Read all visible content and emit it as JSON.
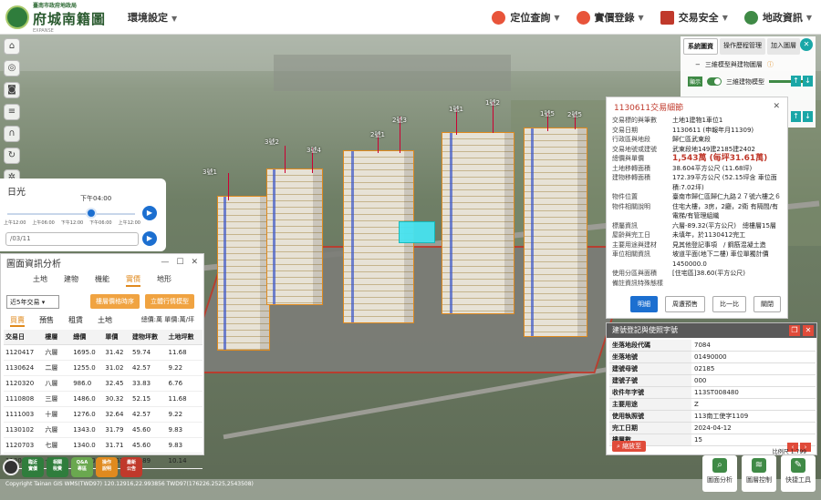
{
  "header": {
    "logo_sub": "臺南市政府地政局",
    "logo_main": "府城南籍圖",
    "logo_en": "EXPANSE",
    "env_menu": "環境設定",
    "nav": [
      {
        "label": "定位查詢",
        "icon": "location-pin-icon",
        "color": "#e8543a"
      },
      {
        "label": "實價登錄",
        "icon": "coin-icon",
        "color": "#e8543a"
      },
      {
        "label": "交易安全",
        "icon": "house-shield-icon",
        "color": "#c0392b"
      },
      {
        "label": "地政資訊",
        "icon": "sprout-icon",
        "color": "#3f8a46"
      }
    ]
  },
  "left_tools": [
    "home-icon",
    "locate-icon",
    "camera-icon",
    "layers-icon",
    "measure-icon",
    "rotate-icon",
    "settings-icon"
  ],
  "sun": {
    "title": "日光",
    "time": "下午04:00",
    "ticks": [
      "上午12:00",
      "上午06:00",
      "下午12:00",
      "下午06:00",
      "上午12:00"
    ],
    "date": "/03/11",
    "level": 0.66
  },
  "analysis": {
    "title": "圖面資訊分析",
    "tabs": [
      "土地",
      "建物",
      "機能",
      "實價",
      "地形"
    ],
    "active_tab": "實價",
    "period": "近5年交易",
    "buttons": [
      "樓層價格時序",
      "立體行情模型"
    ],
    "subtabs": [
      "買賣",
      "預售",
      "租賃",
      "土地"
    ],
    "unit_note": "總價:萬 單價:萬/坪",
    "columns": [
      "交易日",
      "樓層",
      "總價",
      "單價",
      "建物坪數",
      "土地坪數"
    ],
    "rows": [
      [
        "1120417",
        "六層",
        "1695.0",
        "31.42",
        "59.74",
        "11.68"
      ],
      [
        "1130624",
        "二層",
        "1255.0",
        "31.02",
        "42.57",
        "9.22"
      ],
      [
        "1120320",
        "八層",
        "986.0",
        "32.45",
        "33.83",
        "6.76"
      ],
      [
        "1110808",
        "三層",
        "1486.0",
        "30.32",
        "52.15",
        "11.68"
      ],
      [
        "1111003",
        "十層",
        "1276.0",
        "32.64",
        "42.57",
        "9.22"
      ],
      [
        "1130102",
        "六層",
        "1343.0",
        "31.79",
        "45.60",
        "9.83"
      ],
      [
        "1120703",
        "七層",
        "1340.0",
        "31.71",
        "45.60",
        "9.83"
      ],
      [
        "1130620",
        "十四層",
        "1346.0",
        "31.63",
        "45.89",
        "10.14"
      ]
    ]
  },
  "bottom_left": [
    {
      "label": "臨近\n實價",
      "color": "#2f7d3c"
    },
    {
      "label": "相關\n稅費",
      "color": "#2f7d3c"
    },
    {
      "label": "Q&A\n專區",
      "color": "#6aa84f"
    },
    {
      "label": "操作\n說明",
      "color": "#e08a1e"
    },
    {
      "label": "最新\n公告",
      "color": "#c0392b"
    }
  ],
  "layers": {
    "tabs": [
      "系統圖資",
      "操作歷程管理",
      "加入圖層"
    ],
    "group": "三維模型與建物圖層",
    "item": "三維建物模型",
    "toggle_label": "顯示"
  },
  "detail": {
    "title": "1130611交易細節",
    "fields": [
      [
        "交易標的與筆數",
        "土地1建物1車位1"
      ],
      [
        "交易日期",
        "1130611 (申報年月11309)"
      ],
      [
        "行政區與地段",
        "歸仁區武東段"
      ],
      [
        "交易地號或建號",
        "武東段地149建2185建2402"
      ],
      [
        "總價與單價",
        "1,543萬 (每坪31.61萬)"
      ],
      [
        "土地移轉面積",
        "38.604平方公尺 (11.68坪)"
      ],
      [
        "建物移轉面積",
        "172.39平方公尺 (52.15坪含 車位面積:7.02坪)"
      ],
      [
        "物件位置",
        "臺南市歸仁區歸仁九路２７號六樓之６"
      ],
      [
        "物件相關說明",
        "住宅大樓，3房，2廳，2衛 有隔間/有電梯/有管理組織"
      ],
      [
        "標屬資訊",
        "六層-89.32(平方公尺)　總樓層15層"
      ],
      [
        "屋齡與完工日",
        "未填年，於1130412完工"
      ],
      [
        "主要用途與建材",
        "見其他登記事項　/ 鋼筋混凝土造"
      ],
      [
        "車位相關資訊",
        "坡道平面(地下二樓) 車位單獨計價1450000.0"
      ],
      [
        "使用分區與面積",
        "[住宅區]38.60(平方公尺)"
      ],
      [
        "備註資訊特殊態樣",
        ""
      ]
    ],
    "buttons": [
      "明細",
      "周遭預售",
      "比一比",
      "關閉"
    ]
  },
  "registry": {
    "title": "建號登記與使照字號",
    "rows": [
      [
        "坐落地段代碼",
        "7084"
      ],
      [
        "坐落地號",
        "01490000"
      ],
      [
        "建號母號",
        "02185"
      ],
      [
        "建號子號",
        "000"
      ],
      [
        "收件年字號",
        "113ST008480"
      ],
      [
        "主要用途",
        "Z"
      ],
      [
        "使用執照號",
        "113南工使字1109"
      ],
      [
        "完工日期",
        "2024-04-12"
      ],
      [
        "樓層數",
        "15"
      ]
    ],
    "footer": "縮放至"
  },
  "bottom_right": [
    {
      "label": "圖面分析",
      "icon": "magnify-icon"
    },
    {
      "label": "圖層控制",
      "icon": "stack-icon"
    },
    {
      "label": "快捷工具",
      "icon": "wrench-icon"
    }
  ],
  "scale": "比例尺 1:799",
  "copyright": "Copyright Tainan GIS WMS(TWD97) 120.12916,22.993856 TWD97(176226.2525,2543508)",
  "map_labels": [
    "3號1",
    "3號2",
    "2號1",
    "2號3",
    "1號1",
    "1號2",
    "1號5",
    "3號4",
    "2號5"
  ]
}
